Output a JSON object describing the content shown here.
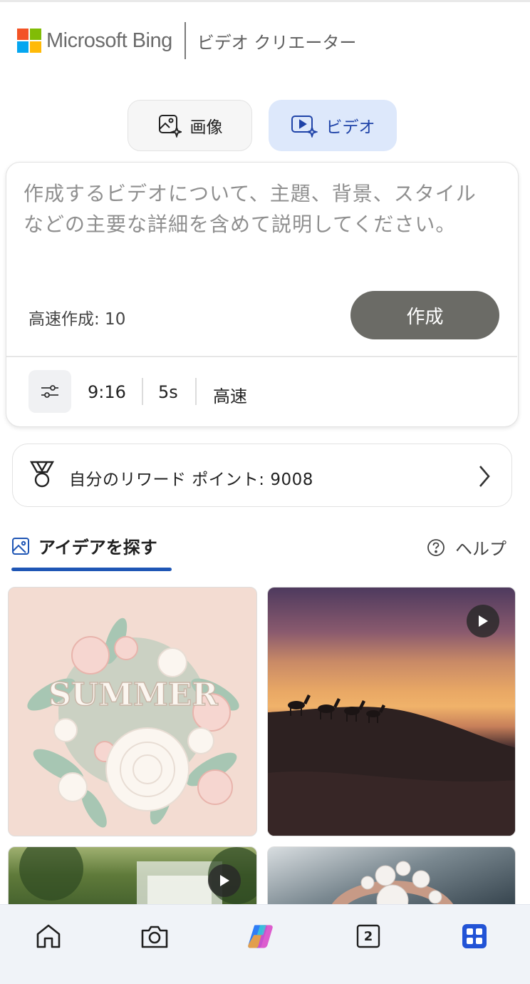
{
  "header": {
    "brand": "Microsoft Bing",
    "title": "ビデオ クリエーター",
    "logo_colors": [
      "#f35325",
      "#81bc06",
      "#05a6f0",
      "#ffba08"
    ]
  },
  "mode_toggle": {
    "image_label": "画像",
    "video_label": "ビデオ",
    "selected": "video"
  },
  "prompt_card": {
    "placeholder": "作成するビデオについて、主題、背景、スタイルなどの主要な詳細を含めて説明してください。",
    "fast_create_label": "高速作成: 10",
    "create_button": "作成",
    "options": {
      "aspect_ratio": "9:16",
      "duration": "5s",
      "speed": "高速"
    }
  },
  "rewards": {
    "label": "自分のリワード ポイント: 9008"
  },
  "ideas": {
    "tab_label": "アイデアを探す",
    "help_label": "ヘルプ",
    "tiles": [
      {
        "name": "summer-paper-flowers",
        "text": "SUMMER",
        "has_play": false
      },
      {
        "name": "camel-desert-sunset",
        "has_play": true
      },
      {
        "name": "forest-waterfall",
        "has_play": true
      },
      {
        "name": "pearl-jewelry",
        "has_play": false
      }
    ]
  },
  "bottom_nav": {
    "tab_count": "2",
    "items": [
      "home-icon",
      "camera-icon",
      "copilot-icon",
      "tabs-icon",
      "apps-icon"
    ],
    "active": "apps-icon",
    "accent": "#2253d6"
  }
}
